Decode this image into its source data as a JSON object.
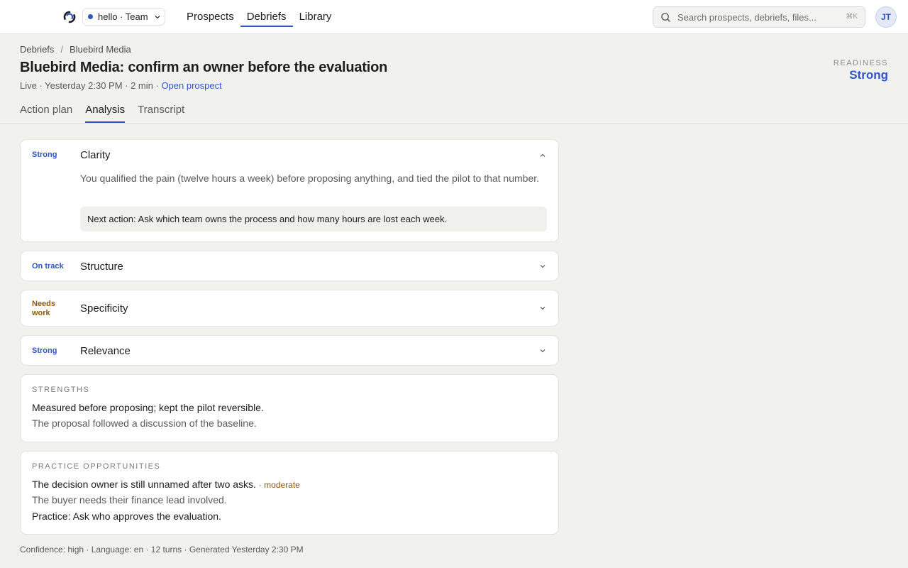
{
  "topbar": {
    "workspace_label": "hello · Team",
    "nav": [
      {
        "label": "Prospects"
      },
      {
        "label": "Debriefs"
      },
      {
        "label": "Library"
      }
    ],
    "search_placeholder": "Search prospects, debriefs, files...",
    "search_shortcut": "⌘K",
    "avatar_initials": "JT",
    "accent_color": "#2f55c9"
  },
  "breadcrumb": {
    "parent": "Debriefs",
    "separator": "/",
    "current": "Bluebird Media"
  },
  "header": {
    "title": "Bluebird Media: confirm an owner before the evaluation",
    "meta_text": "Live · Yesterday 2:30 PM · 2 min · ",
    "meta_link": "Open prospect",
    "readiness_label": "READINESS",
    "readiness_value": "Strong"
  },
  "tabs": [
    {
      "label": "Action plan"
    },
    {
      "label": "Analysis"
    },
    {
      "label": "Transcript"
    }
  ],
  "rubric": [
    {
      "badge": "Strong",
      "name": "Clarity",
      "expanded": true,
      "body": "You qualified the pain (twelve hours a week) before proposing anything, and tied the pilot to that number.",
      "next_action": "Next action: Ask which team owns the process and how many hours are lost each week."
    },
    {
      "badge": "On track",
      "name": "Structure",
      "expanded": false
    },
    {
      "badge_line1": "Needs",
      "badge_line2": "work",
      "name": "Specificity",
      "expanded": false
    },
    {
      "badge": "Strong",
      "name": "Relevance",
      "expanded": false
    }
  ],
  "strengths": {
    "label": "STRENGTHS",
    "title": "Measured before proposing; kept the pilot reversible.",
    "detail": "The proposal followed a discussion of the baseline."
  },
  "practice": {
    "label": "PRACTICE OPPORTUNITIES",
    "title": "The decision owner is still unnamed after two asks.",
    "severity": "· moderate",
    "detail": "The buyer needs their finance lead involved.",
    "practice": "Practice: Ask who approves the evaluation."
  },
  "footer": "Confidence: high · Language: en · 12 turns · Generated Yesterday 2:30 PM"
}
